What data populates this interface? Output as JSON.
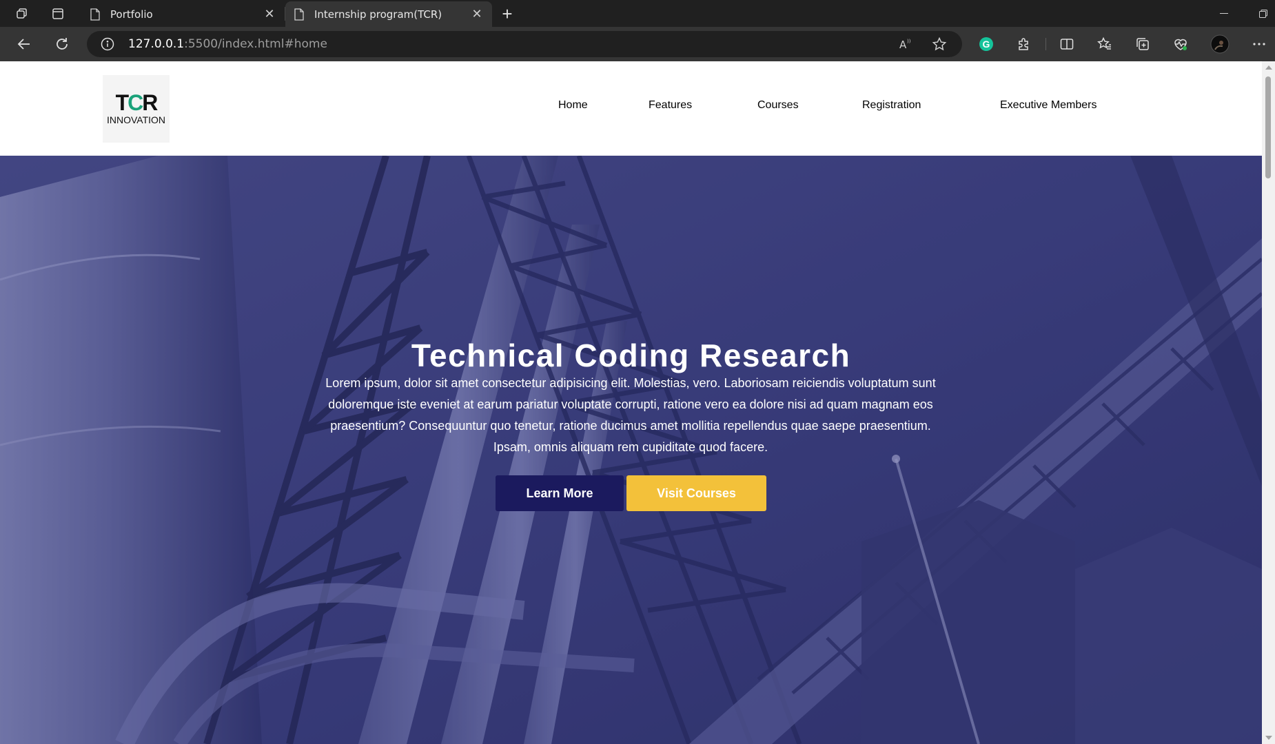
{
  "browser": {
    "tabs": [
      {
        "title": "Portfolio",
        "active": false
      },
      {
        "title": "Internship program(TCR)",
        "active": true
      }
    ],
    "url": {
      "host": "127.0.0.1",
      "rest": ":5500/index.html#home"
    }
  },
  "site": {
    "logo": {
      "mark_left": "T",
      "mark_accent": "C",
      "mark_right": "R",
      "sub": "INNOVATION"
    },
    "nav": [
      "Home",
      "Features",
      "Courses",
      "Registration",
      "Executive Members"
    ],
    "hero": {
      "title": "Technical Coding Research",
      "text": "Lorem ipsum, dolor sit amet consectetur adipisicing elit. Molestias, vero. Laboriosam reiciendis voluptatum sunt doloremque iste eveniet at earum pariatur voluptate corrupti, ratione vero ea dolore nisi ad quam magnam eos praesentium? Consequuntur quo tenetur, ratione ducimus amet mollitia repellendus quae saepe praesentium. Ipsam, omnis aliquam rem cupiditate quod facere.",
      "buttons": {
        "learn": "Learn More",
        "visit": "Visit Courses"
      }
    }
  },
  "colors": {
    "nav_text": "#1b1a5e",
    "primary": "#1b1a5e",
    "accent": "#f3c13a",
    "hero_overlay": "#3a3c79"
  }
}
